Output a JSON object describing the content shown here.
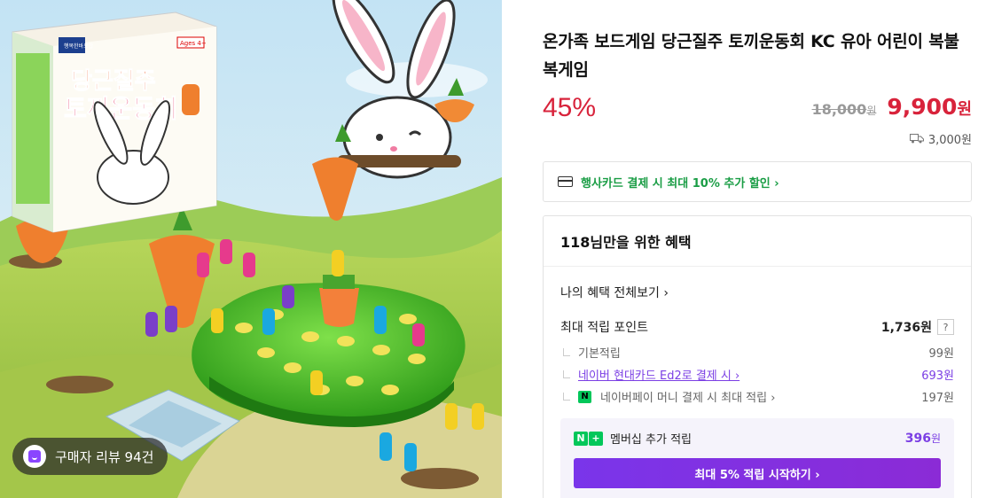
{
  "image": {
    "box_brand": "행복한바오밥",
    "box_title_line1": "당근질주",
    "box_title_line2": "토끼운동회",
    "box_age": "Ages 4+",
    "review_label": "구매자 리뷰 94건"
  },
  "product": {
    "title": "온가족 보드게임 당근질주 토끼운동회 KC 유아 어린이 복불복게임",
    "discount": "45%",
    "original_price": "18,000",
    "original_unit": "원",
    "sale_price": "9,900",
    "sale_unit": "원",
    "shipping": "3,000원"
  },
  "card_banner": {
    "text": "행사카드 결제 시 최대 10% 추가 할인 ›"
  },
  "benefit": {
    "header": "118님만을 위한 혜택",
    "my_benefit_link": "나의 혜택 전체보기 ›",
    "max_points_label": "최대 적립 포인트",
    "max_points_value": "1,736원",
    "help": "?",
    "rows": [
      {
        "label": "기본적립",
        "value": "99원"
      },
      {
        "label": "네이버 현대카드 Ed2로 결제 시 ›",
        "value": "693원"
      },
      {
        "label": "네이버페이 머니 결제 시 최대 적립 ›",
        "value": "197원"
      }
    ],
    "npay_badge": "N",
    "membership": {
      "badge_n": "N",
      "badge_plus": "+",
      "label": "멤버십 추가 적립",
      "value": "396",
      "unit": "원",
      "button": "최대 5% 적립 시작하기 ›"
    }
  },
  "colors": {
    "price_red": "#d8233b",
    "naver_green": "#03c75a",
    "membership_purple": "#7b3fe4",
    "card_banner_green": "#1a9d45"
  }
}
